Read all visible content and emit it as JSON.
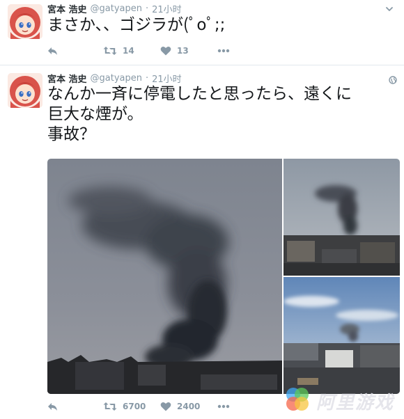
{
  "tweets": [
    {
      "fullname": "宮本 浩史",
      "username": "@gatyapen",
      "separator": "·",
      "time": "21小时",
      "text": "まさか、、ゴジラが(ﾟoﾟ;;",
      "retweets": "14",
      "likes": "13",
      "avatar_icon": "anime-girl-avatar",
      "caret_icon": "chevron-down-icon"
    },
    {
      "fullname": "宮本 浩史",
      "username": "@gatyapen",
      "separator": "·",
      "time": "21小时",
      "text": "なんか一斉に停電したと思ったら、遠くに\n巨大な煙が。\n事故？",
      "retweets": "6700",
      "likes": "2400",
      "avatar_icon": "anime-girl-avatar",
      "globe_icon": "globe-icon"
    }
  ],
  "watermark": {
    "text": "阿里游戏",
    "logo_icon": "colored-circles-logo"
  },
  "colors": {
    "text": "#14171a",
    "secondary": "#8899a6",
    "divider": "#e1e8ed"
  }
}
